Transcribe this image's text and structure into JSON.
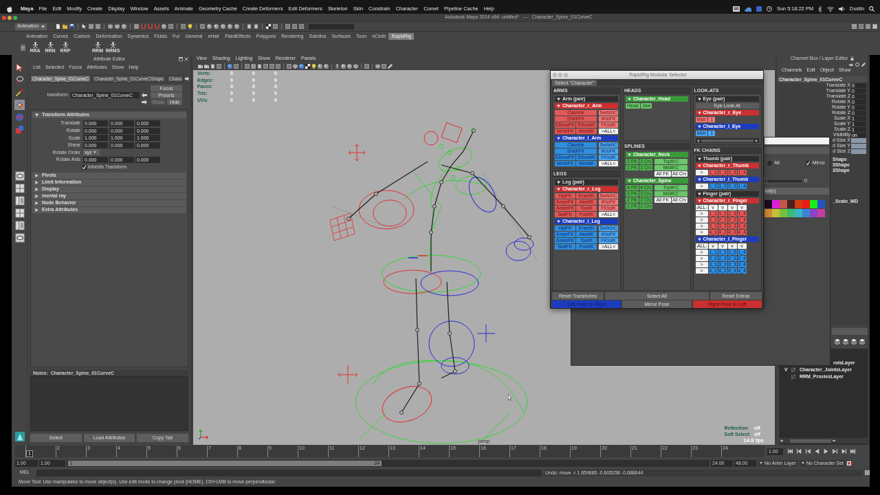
{
  "menu_bar": {
    "app": "Maya",
    "items": [
      "File",
      "Edit",
      "Modify",
      "Create",
      "Display",
      "Window",
      "Assets",
      "Animate",
      "Geometry Cache",
      "Create Deformers",
      "Edit Deformers",
      "Skeleton",
      "Skin",
      "Constrain",
      "Character",
      "Comet",
      "Pipeline Cache",
      "Help"
    ],
    "clock": "Sun 5:18:22 PM",
    "user": "Dustin"
  },
  "window": {
    "title": "Autodesk Maya 2014 x64: untitled*   ---   Character_Spine_01CurveC"
  },
  "status_line": {
    "menu_set": "Animation"
  },
  "shelf": {
    "tabs": [
      {
        "label": "Animation",
        "selected": false
      },
      {
        "label": "Curves",
        "selected": false
      },
      {
        "label": "Custom",
        "selected": false
      },
      {
        "label": "Deformation",
        "selected": false
      },
      {
        "label": "Dynamics",
        "selected": false
      },
      {
        "label": "Fluids",
        "selected": false
      },
      {
        "label": "Fur",
        "selected": false
      },
      {
        "label": "General",
        "selected": false
      },
      {
        "label": "nHair",
        "selected": false
      },
      {
        "label": "PaintEffects",
        "selected": false
      },
      {
        "label": "Polygons",
        "selected": false
      },
      {
        "label": "Rendering",
        "selected": false
      },
      {
        "label": "Subdivs",
        "selected": false
      },
      {
        "label": "Surfaces",
        "selected": false
      },
      {
        "label": "Toon",
        "selected": false
      },
      {
        "label": "nCloth",
        "selected": false
      },
      {
        "label": "RapidRig",
        "selected": true
      }
    ],
    "button_groups": [
      [
        "RRA",
        "RRN",
        "RRP"
      ],
      [
        "RRM",
        "RRMS"
      ]
    ]
  },
  "toolbox": {
    "tools": [
      {
        "kind": "select",
        "selected": false
      },
      {
        "kind": "lasso",
        "selected": false
      },
      {
        "kind": "paint",
        "selected": false
      },
      {
        "kind": "move",
        "selected": true
      },
      {
        "kind": "rotate",
        "selected": false
      },
      {
        "kind": "scale",
        "selected": false
      }
    ]
  },
  "attribute_editor": {
    "title": "Attribute Editor",
    "menu": [
      "List",
      "Selected",
      "Focus",
      "Attributes",
      "Show",
      "Help"
    ],
    "tabs": [
      {
        "label": "Character_Spine_01CurveC",
        "selected": true
      },
      {
        "label": "Character_Spine_01CurveCShape",
        "selected": false
      },
      {
        "label": "Chara",
        "selected": false
      }
    ],
    "node_label": "transform:",
    "node_name": "Character_Spine_01CurveC",
    "buttons": [
      {
        "label": "Focus",
        "disabled": false
      },
      {
        "label": "Presets",
        "disabled": false
      }
    ],
    "visibility_buttons": [
      {
        "label": "Show",
        "disabled": true
      },
      {
        "label": "Hide",
        "disabled": false
      }
    ],
    "sections": [
      {
        "label": "Transform Attributes",
        "expanded": true,
        "rows": [
          {
            "kind": "vector",
            "label": "Translate",
            "values": [
              "0.000",
              "0.000",
              "0.000"
            ]
          },
          {
            "kind": "vector",
            "label": "Rotate",
            "values": [
              "0.000",
              "0.000",
              "0.000"
            ]
          },
          {
            "kind": "vector",
            "label": "Scale",
            "values": [
              "1.000",
              "1.000",
              "1.000"
            ]
          },
          {
            "kind": "vector",
            "label": "Shear",
            "values": [
              "0.000",
              "0.000",
              "0.000"
            ]
          },
          {
            "kind": "dropdown",
            "label": "Rotate Order",
            "value": "xyz"
          },
          {
            "kind": "vector",
            "label": "Rotate Axis",
            "values": [
              "0.000",
              "0.000",
              "0.000"
            ]
          },
          {
            "kind": "checkbox",
            "label": "Inherits Transform",
            "checked": true
          }
        ]
      },
      {
        "label": "Pivots",
        "expanded": false
      },
      {
        "label": "Limit Information",
        "expanded": false
      },
      {
        "label": "Display",
        "expanded": false
      },
      {
        "label": "mental ray",
        "expanded": false
      },
      {
        "label": "Node Behavior",
        "expanded": false
      },
      {
        "label": "Extra Attributes",
        "expanded": false
      }
    ],
    "notes_label": "Notes:  Character_Spine_01CurveC",
    "actions": [
      "Select",
      "Load Attributes",
      "Copy Tab"
    ]
  },
  "viewport": {
    "menu": [
      "View",
      "Shading",
      "Lighting",
      "Show",
      "Renderer",
      "Panels"
    ],
    "hud": [
      {
        "label": "Verts:",
        "values": [
          "0",
          "0",
          "0"
        ]
      },
      {
        "label": "Edges:",
        "values": [
          "0",
          "0",
          "0"
        ]
      },
      {
        "label": "Faces:",
        "values": [
          "0",
          "0",
          "0"
        ]
      },
      {
        "label": "Tris:",
        "values": [
          "0",
          "0",
          "0"
        ]
      },
      {
        "label": "UVs:",
        "values": [
          "0",
          "0",
          "0"
        ]
      }
    ],
    "camera": "persp",
    "hud_right": [
      {
        "label": "Reflection:",
        "value": "off"
      },
      {
        "label": "Soft Select:",
        "value": "off"
      }
    ],
    "fps": "14.8 fps"
  },
  "rapidrig": {
    "title": "RapidRig Modular Selector",
    "tab": "Select \"Character\"",
    "columns": [
      [
        {
          "label": "ARMS",
          "groups": [
            {
              "pair": "Arm (pair)",
              "expanded": true,
              "right": {
                "name": "Character_r_Arm",
                "kind": "limb",
                "expanded": true,
                "main": [
                  [
                    "Clavicle"
                  ],
                  [
                    "ShldrFK"
                  ],
                  [
                    "ElbowFK",
                    "ElbowIK"
                  ],
                  [
                    "WristFK",
                    "WristIK"
                  ]
                ],
                "switches": [
                  "SwitchC",
                  "IKtoFK",
                  "FKtoIK"
                ],
                "select_all": [
                  ">ALL<"
                ]
              },
              "left": {
                "name": "Character_l_Arm",
                "kind": "limb",
                "expanded": true,
                "main": [
                  [
                    "Clavicle"
                  ],
                  [
                    "ShldrFK"
                  ],
                  [
                    "ElbowFK",
                    "ElbowIK"
                  ],
                  [
                    "WristFK",
                    "WristIK"
                  ]
                ],
                "switches": [
                  "SwitchC",
                  "IKtoFK",
                  "FKtoIK"
                ],
                "select_all": [
                  ">ALL<"
                ]
              }
            }
          ]
        },
        {
          "label": "LEGS",
          "groups": [
            {
              "pair": "Leg (pair)",
              "expanded": true,
              "right": {
                "name": "Character_r_Leg",
                "kind": "limb",
                "expanded": true,
                "main": [
                  [
                    "HipFK",
                    "KneeIK"
                  ],
                  [
                    "KneeFK",
                    "HeelIK"
                  ],
                  [
                    "AnkleFK",
                    "ToeIK"
                  ],
                  [
                    "BallFK",
                    "FootIK"
                  ]
                ],
                "switches": [
                  "SwitchC",
                  "IKtoFK",
                  "FKtoIK"
                ],
                "select_all": [
                  ">ALL<"
                ]
              },
              "left": {
                "name": "Character_l_Leg",
                "kind": "limb",
                "expanded": true,
                "main": [
                  [
                    "HipFK",
                    "KneeIK"
                  ],
                  [
                    "KneeFK",
                    "HeelIK"
                  ],
                  [
                    "AnkleFK",
                    "ToeIK"
                  ],
                  [
                    "BallFK",
                    "FootIK"
                  ]
                ],
                "switches": [
                  "SwitchC",
                  "IKtoFK",
                  "FKtoIK"
                ],
                "select_all": [
                  ">ALL<"
                ]
              }
            }
          ]
        }
      ],
      [
        {
          "label": "HEADS",
          "groups": [
            {
              "center": [
                {
                  "name": "Character_Head",
                  "kind": "simple",
                  "expanded": true,
                  "buttons": [
                    "Head",
                    "Jaw"
                  ]
                }
              ]
            }
          ]
        },
        {
          "label": "SPLINES",
          "groups": [
            {
              "center": [
                {
                  "name": "Character_Neck",
                  "kind": "spline",
                  "expanded": true,
                  "main": [
                    [
                      "2 FK",
                      "2 Crv"
                    ],
                    [
                      "1 FK",
                      "1 Crv"
                    ]
                  ],
                  "switches": [
                    "TopIKC",
                    "MidIKC"
                  ],
                  "select_all": [
                    "All FK",
                    "All Crv"
                  ]
                },
                {
                  "name": "Character_Spine",
                  "kind": "spline",
                  "expanded": true,
                  "main": [
                    [
                      "4 FK",
                      "4 Crv"
                    ],
                    [
                      "3 FK",
                      "3 Crv"
                    ],
                    [
                      "2 FK",
                      "2 Crv"
                    ],
                    [
                      "1 FK",
                      "1 Crv"
                    ]
                  ],
                  "switches": [
                    "TopIKC",
                    "MidIKC"
                  ],
                  "select_all": [
                    "All FK",
                    "All Crv"
                  ]
                }
              ]
            }
          ]
        }
      ],
      [
        {
          "label": "LOOK-ATS",
          "groups": [
            {
              "pair": "Eye (pair)",
              "expanded": true,
              "pair_button": "Eye Look-At",
              "right": {
                "name": "Character_r_Eye",
                "kind": "simple",
                "expanded": true,
                "buttons": [
                  "Mstr",
                  "1"
                ]
              },
              "left": {
                "name": "Character_l_Eye",
                "kind": "simple",
                "expanded": true,
                "buttons": [
                  "Mstr",
                  "1"
                ]
              }
            }
          ]
        },
        {
          "label": "FK CHAINS",
          "groups": [
            {
              "pair": "Thumb (pair)",
              "expanded": true,
              "right": {
                "name": "Character_r_Thumb",
                "kind": "chain",
                "expanded": true,
                "rows": [
                  {
                    "pick": ">",
                    "cells": [
                      "1_1",
                      "1_2",
                      "1_3",
                      "1_4"
                    ]
                  }
                ]
              },
              "left": {
                "name": "Character_l_Thumb",
                "kind": "chain",
                "expanded": true,
                "rows": [
                  {
                    "pick": ">",
                    "cells": [
                      "1_1",
                      "1_2",
                      "1_3",
                      "1_4"
                    ]
                  }
                ]
              }
            },
            {
              "pair": "Finger (pair)",
              "expanded": true,
              "right": {
                "name": "Character_r_Finger",
                "kind": "chain",
                "expanded": true,
                "corner": "-ALL-",
                "column_picks": [
                  "v",
                  "v",
                  "v",
                  "v"
                ],
                "rows": [
                  {
                    "pick": ">",
                    "cells": [
                      "1_1",
                      "1_2",
                      "1_3",
                      "1_4"
                    ]
                  },
                  {
                    "pick": ">",
                    "cells": [
                      "2_1",
                      "2_2",
                      "2_3",
                      "2_4"
                    ]
                  },
                  {
                    "pick": ">",
                    "cells": [
                      "3_1",
                      "3_2",
                      "3_3",
                      "3_4"
                    ]
                  },
                  {
                    "pick": ">",
                    "cells": [
                      "4_1",
                      "4_2",
                      "4_3",
                      "4_4"
                    ]
                  }
                ]
              },
              "left": {
                "name": "Character_l_Finger",
                "kind": "chain",
                "expanded": true,
                "corner": "-ALL-",
                "column_picks": [
                  "v",
                  "v",
                  "v",
                  "v"
                ],
                "rows": [
                  {
                    "pick": ">",
                    "cells": [
                      "1_1",
                      "1_2",
                      "1_3",
                      "1_4"
                    ]
                  },
                  {
                    "pick": ">",
                    "cells": [
                      "2_1",
                      "2_2",
                      "2_3",
                      "2_4"
                    ]
                  },
                  {
                    "pick": ">",
                    "cells": [
                      "3_1",
                      "3_2",
                      "3_3",
                      "3_4"
                    ]
                  },
                  {
                    "pick": ">",
                    "cells": [
                      "4_1",
                      "4_2",
                      "4_3",
                      "4_4"
                    ]
                  }
                ]
              }
            }
          ]
        }
      ]
    ],
    "footer": [
      [
        {
          "label": "Reset Transforms",
          "kind": "plain"
        },
        {
          "label": "Select All",
          "kind": "plain"
        },
        {
          "label": "Reset Extras",
          "kind": "plain"
        }
      ],
      [
        {
          "label": "Left Pose to Right",
          "kind": "left"
        },
        {
          "label": "Mirror Pose",
          "kind": "plain"
        },
        {
          "label": "Right Pose to Left",
          "kind": "right"
        }
      ]
    ]
  },
  "options_panel": {
    "options": [
      {
        "kind": "radio",
        "label": "All",
        "selected": false
      },
      {
        "kind": "checkbox",
        "label": "Mirror",
        "checked": true
      }
    ],
    "slider": {
      "level": 0,
      "reading": "0"
    },
    "frame_label": "rol(s)",
    "swatches": [
      {
        "color": "#1e0a22"
      },
      {
        "color": "#e020d8"
      },
      {
        "color": "#c05848"
      },
      {
        "color": "#4a2020"
      },
      {
        "color": "#d03c14"
      },
      {
        "color": "#f01818"
      },
      {
        "color": "#18f018"
      },
      {
        "color": "#2454c4"
      },
      {
        "color": "#d08a34"
      },
      {
        "color": "#c4c03c"
      },
      {
        "color": "#74c040"
      },
      {
        "color": "#3cbc70"
      },
      {
        "color": "#3cb4c4"
      },
      {
        "color": "#3c84d4"
      },
      {
        "color": "#8844c8"
      },
      {
        "color": "#c440a0"
      }
    ]
  },
  "channel_box": {
    "title": "Channel Box / Layer Editor",
    "menu": [
      "Channels",
      "Edit",
      "Object",
      "Show"
    ],
    "object": "Character_Spine_01CurveC",
    "channels": [
      {
        "label": "Translate X",
        "value": "0",
        "selected": false
      },
      {
        "label": "Translate Y",
        "value": "0",
        "selected": false
      },
      {
        "label": "Translate Z",
        "value": "0",
        "selected": false
      },
      {
        "label": "Rotate X",
        "value": "0",
        "selected": false
      },
      {
        "label": "Rotate Y",
        "value": "0",
        "selected": false
      },
      {
        "label": "Rotate Z",
        "value": "0",
        "selected": false
      },
      {
        "label": "Scale X",
        "value": "1",
        "selected": false
      },
      {
        "label": "Scale Y",
        "value": "1",
        "selected": false
      },
      {
        "label": "Scale Z",
        "value": "1",
        "selected": false
      },
      {
        "label": "Visibility",
        "value": "on",
        "selected": false
      },
      {
        "label": "d Size X",
        "selected": true
      },
      {
        "label": "d Size Y",
        "selected": true
      },
      {
        "label": "d Size Z",
        "selected": true
      }
    ],
    "shapes": [
      "Shape",
      "3Shape",
      "3Shape"
    ],
    "outputs": [
      "_Scale_MD"
    ],
    "layers": [
      {
        "name": "rolsLayer"
      },
      {
        "flag": "V",
        "name": "Character_JointsLayer"
      },
      {
        "name": "RRM_ProxiesLayer"
      }
    ]
  },
  "timeline": {
    "frames": [
      {
        "label": "1",
        "selected": true
      },
      {
        "label": "2",
        "selected": false
      },
      {
        "label": "3",
        "selected": false
      },
      {
        "label": "4",
        "selected": false
      },
      {
        "label": "5",
        "selected": false
      },
      {
        "label": "6",
        "selected": false
      },
      {
        "label": "7",
        "selected": false
      },
      {
        "label": "8",
        "selected": false
      },
      {
        "label": "9",
        "selected": false
      },
      {
        "label": "10",
        "selected": false
      },
      {
        "label": "11",
        "selected": false
      },
      {
        "label": "12",
        "selected": false
      },
      {
        "label": "13",
        "selected": false
      },
      {
        "label": "14",
        "selected": false
      },
      {
        "label": "15",
        "selected": false
      },
      {
        "label": "16",
        "selected": false
      },
      {
        "label": "17",
        "selected": false
      },
      {
        "label": "18",
        "selected": false
      },
      {
        "label": "19",
        "selected": false
      },
      {
        "label": "20",
        "selected": false
      },
      {
        "label": "21",
        "selected": false
      },
      {
        "label": "22",
        "selected": false
      },
      {
        "label": "23",
        "selected": false
      },
      {
        "label": "24",
        "selected": false
      }
    ],
    "current_time": "1.00"
  },
  "range_slider": {
    "start": "1.00",
    "range_start": "1.00",
    "bar_start": "1",
    "bar_end": "24",
    "level": 0.49,
    "range_end": "24.00",
    "end": "48.00",
    "anim_layer": "No Anim Layer",
    "character_set": "No Character Set"
  },
  "command_line": {
    "language": "MEL",
    "result": "Undo: move -r 1.659685 -0.605258 -0.688644"
  },
  "help_line": {
    "text": "Move Tool: Use manipulator to move object(s). Use edit mode to change pivot (HOME).  Ctrl+LMB to move perpendicular."
  }
}
